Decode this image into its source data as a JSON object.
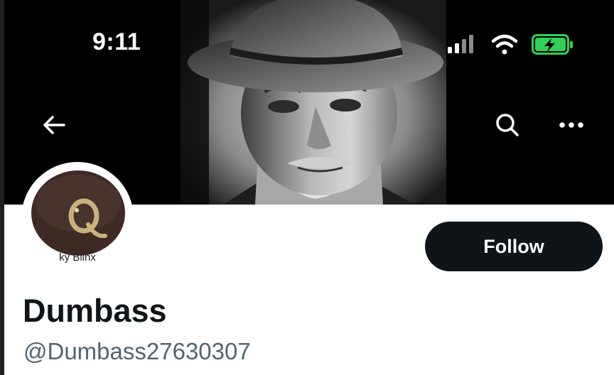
{
  "status_bar": {
    "time": "9:11",
    "signal_icon": "cellular-signal-icon",
    "wifi_icon": "wifi-icon",
    "battery_icon": "battery-charging-icon",
    "battery_color": "#30d158"
  },
  "header": {
    "back_icon": "arrow-left-icon",
    "search_icon": "search-icon",
    "more_icon": "more-horizontal-icon"
  },
  "profile": {
    "avatar_caption": "ky Blinx",
    "display_name": "Dumbass",
    "handle": "@Dumbass27630307",
    "follow_label": "Follow",
    "follow_color": "#0f1419"
  }
}
